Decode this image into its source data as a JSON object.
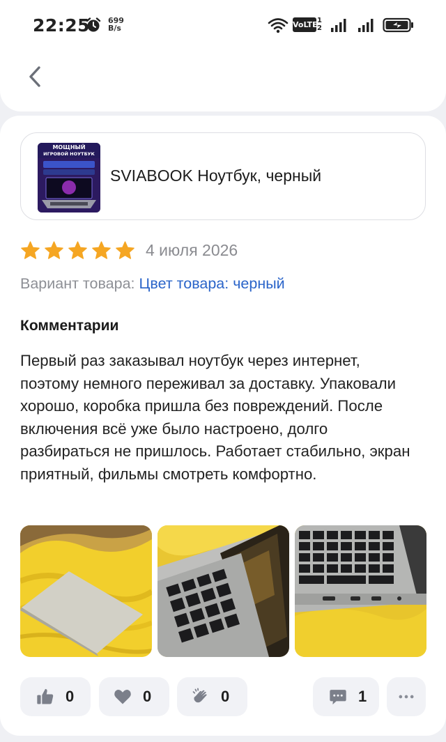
{
  "status_bar": {
    "time": "22:25",
    "net_speed_value": "699",
    "net_speed_unit": "B/s",
    "volte": "VoLTE",
    "sim1": "1",
    "sim2": "2"
  },
  "product": {
    "title": "SVIABOOK Ноутбук, черный",
    "image_title_line1": "МОЩНЫЙ",
    "image_title_line2": "ИГРОВОЙ НОУТБУК"
  },
  "review": {
    "stars": 5,
    "stars_max": 5,
    "date": "4 июля 2026",
    "variant_label": "Вариант товара:",
    "variant_value": "Цвет товара: черный",
    "comments_heading": "Комментарии",
    "comment_text": "Первый раз заказывал ноутбук через интернет, поэтому немного переживал за доставку. Упаковали хорошо, коробка пришла без повреждений. После включения всё уже было настроено, долго разбираться не пришлось. Работает стабильно, экран приятный, фильмы смотреть комфортно."
  },
  "reactions": {
    "likes": "0",
    "hearts": "0",
    "claps": "0",
    "comments": "1"
  },
  "colors": {
    "star": "#f5a623",
    "link": "#2a64c9",
    "muted": "#8a8b90",
    "pill_bg": "#f1f2f6"
  }
}
